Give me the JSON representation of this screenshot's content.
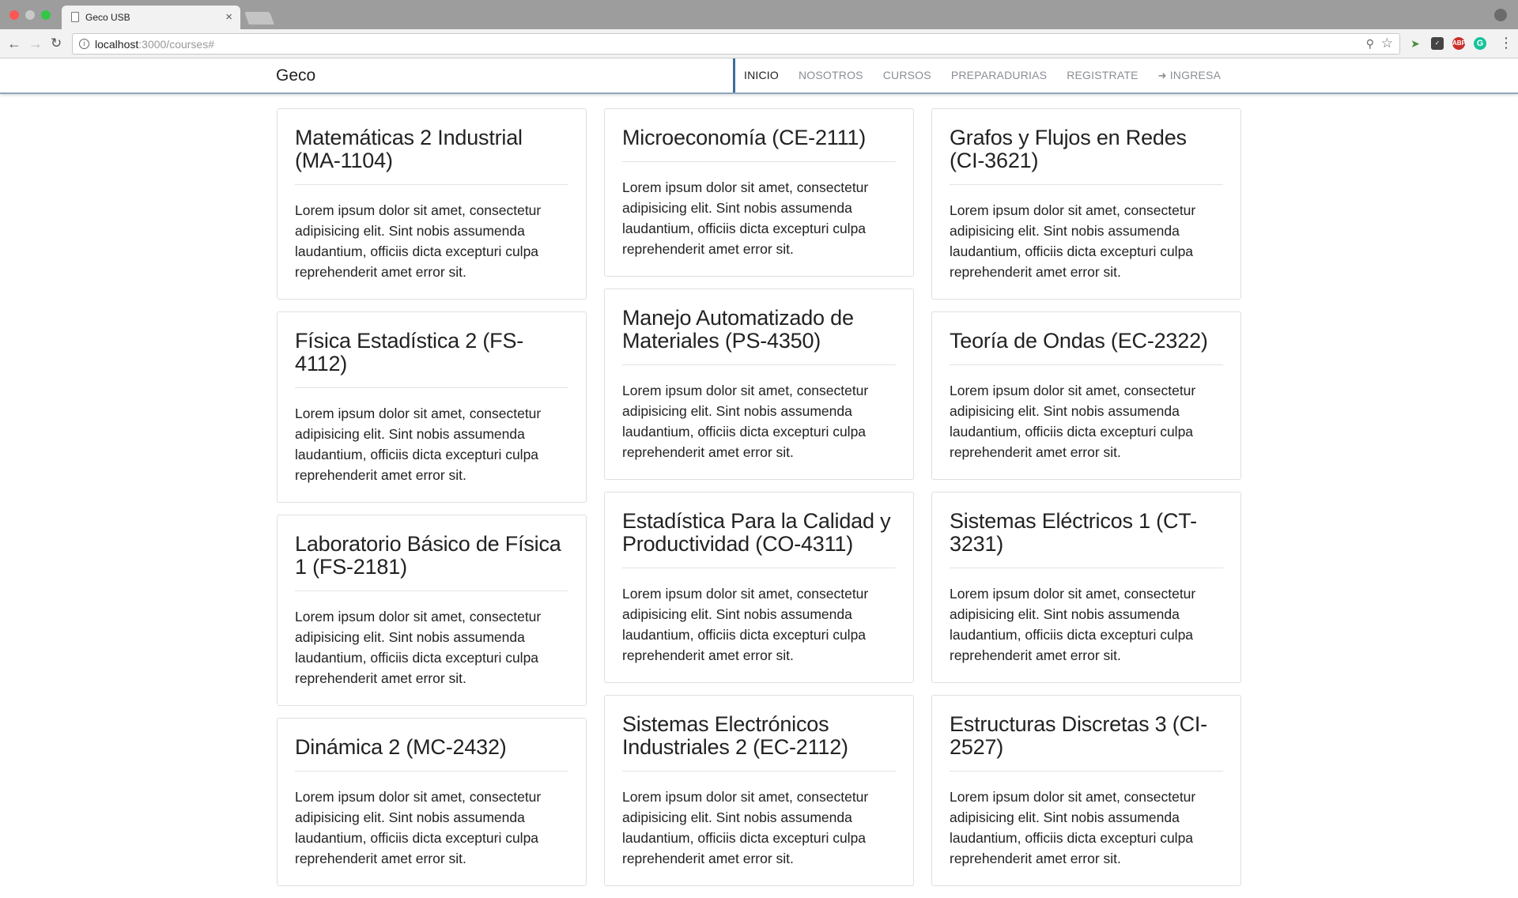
{
  "browser": {
    "tab_title": "Geco USB",
    "tab_close": "×",
    "url_host": "localhost",
    "url_path": ":3000/courses#",
    "icons": [
      "back-arrow-icon",
      "forward-arrow-icon",
      "reload-icon",
      "info-icon",
      "zoom-icon",
      "star-icon",
      "menu-icon"
    ],
    "extensions": [
      "extension-icon",
      "pocket-icon",
      "adblock-icon",
      "grammarly-icon"
    ]
  },
  "navbar": {
    "brand": "Geco",
    "links": [
      {
        "label": "INICIO",
        "active": true
      },
      {
        "label": "NOSOTROS",
        "active": false
      },
      {
        "label": "CURSOS",
        "active": false
      },
      {
        "label": "PREPARADURIAS",
        "active": false
      },
      {
        "label": "REGISTRATE",
        "active": false
      },
      {
        "label": "INGRESA",
        "active": false,
        "icon": "login-icon"
      }
    ]
  },
  "lorem": "Lorem ipsum dolor sit amet, consectetur adipisicing elit. Sint nobis assumenda laudantium, officiis dicta excepturi culpa reprehenderit amet error sit.",
  "columns": [
    {
      "courses": [
        {
          "title": "Matemáticas 2 Industrial (MA-1104)",
          "text": "Lorem ipsum dolor sit amet, consectetur adipisicing elit. Sint nobis assumenda laudantium, officiis dicta excepturi culpa reprehenderit amet error sit."
        },
        {
          "title": "Física Estadística 2 (FS-4112)",
          "text": "Lorem ipsum dolor sit amet, consectetur adipisicing elit. Sint nobis assumenda laudantium, officiis dicta excepturi culpa reprehenderit amet error sit."
        },
        {
          "title": "Laboratorio Básico de Física 1 (FS-2181)",
          "text": "Lorem ipsum dolor sit amet, consectetur adipisicing elit. Sint nobis assumenda laudantium, officiis dicta excepturi culpa reprehenderit amet error sit."
        },
        {
          "title": "Dinámica 2 (MC-2432)",
          "text": "Lorem ipsum dolor sit amet, consectetur adipisicing elit. Sint nobis assumenda laudantium, officiis dicta excepturi culpa reprehenderit amet error sit."
        }
      ]
    },
    {
      "courses": [
        {
          "title": "Microeconomía (CE-2111)",
          "text": "Lorem ipsum dolor sit amet, consectetur adipisicing elit. Sint nobis assumenda laudantium, officiis dicta excepturi culpa reprehenderit amet error sit."
        },
        {
          "title": "Manejo Automatizado de Materiales (PS-4350)",
          "text": "Lorem ipsum dolor sit amet, consectetur adipisicing elit. Sint nobis assumenda laudantium, officiis dicta excepturi culpa reprehenderit amet error sit."
        },
        {
          "title": "Estadística Para la Calidad y Productividad (CO-4311)",
          "text": "Lorem ipsum dolor sit amet, consectetur adipisicing elit. Sint nobis assumenda laudantium, officiis dicta excepturi culpa reprehenderit amet error sit."
        },
        {
          "title": "Sistemas Electrónicos Industriales 2 (EC-2112)",
          "text": "Lorem ipsum dolor sit amet, consectetur adipisicing elit. Sint nobis assumenda laudantium, officiis dicta excepturi culpa reprehenderit amet error sit."
        }
      ]
    },
    {
      "courses": [
        {
          "title": "Grafos y Flujos en Redes (CI-3621)",
          "text": "Lorem ipsum dolor sit amet, consectetur adipisicing elit. Sint nobis assumenda laudantium, officiis dicta excepturi culpa reprehenderit amet error sit."
        },
        {
          "title": "Teoría de Ondas (EC-2322)",
          "text": "Lorem ipsum dolor sit amet, consectetur adipisicing elit. Sint nobis assumenda laudantium, officiis dicta excepturi culpa reprehenderit amet error sit."
        },
        {
          "title": "Sistemas Eléctricos 1 (CT-3231)",
          "text": "Lorem ipsum dolor sit amet, consectetur adipisicing elit. Sint nobis assumenda laudantium, officiis dicta excepturi culpa reprehenderit amet error sit."
        },
        {
          "title": "Estructuras Discretas 3 (CI-2527)",
          "text": "Lorem ipsum dolor sit amet, consectetur adipisicing elit. Sint nobis assumenda laudantium, officiis dicta excepturi culpa reprehenderit amet error sit."
        }
      ]
    }
  ]
}
